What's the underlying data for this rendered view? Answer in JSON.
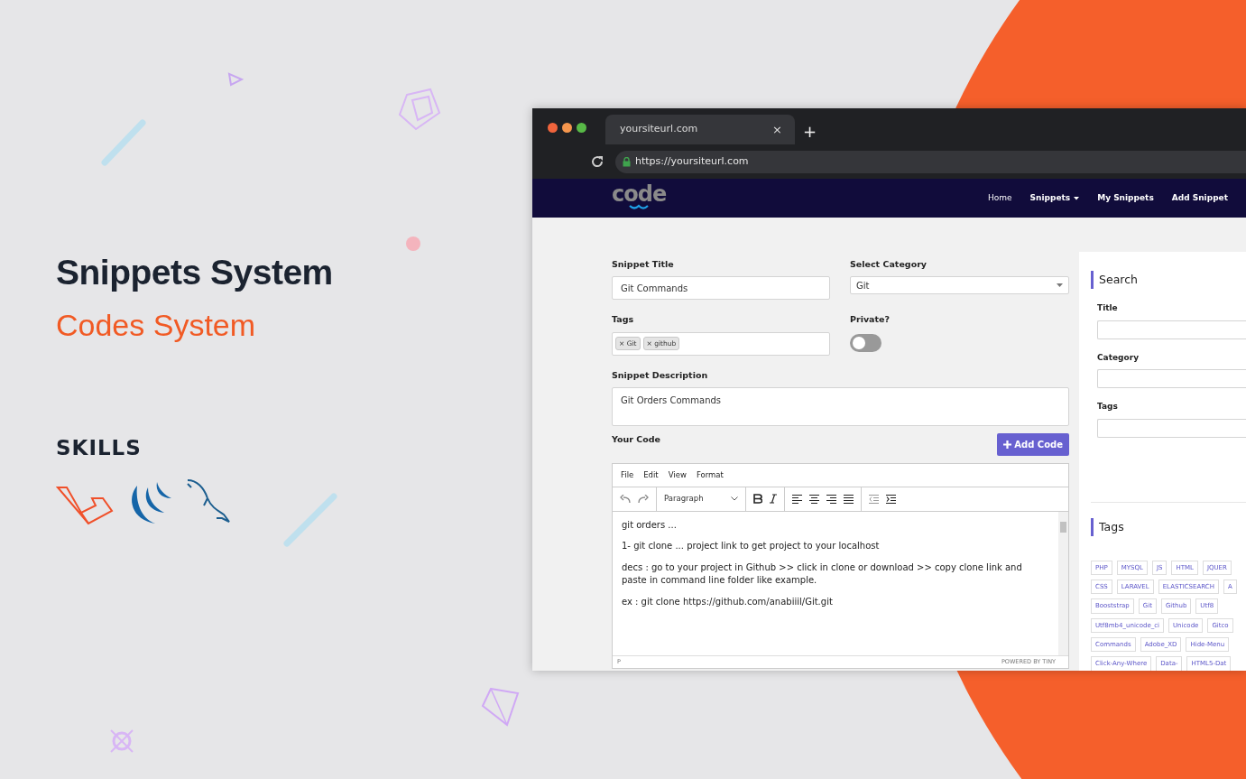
{
  "promo": {
    "title": "Snippets System",
    "subtitle": "Codes System",
    "skills_heading": "SKILLS"
  },
  "browser": {
    "tab_title": "yoursiteurl.com",
    "tab_close": "×",
    "new_tab": "+",
    "url": "https://yoursiteurl.com"
  },
  "navbar": {
    "logo": "code",
    "items": [
      {
        "label": "Home",
        "dropdown": false
      },
      {
        "label": "Snippets",
        "dropdown": true
      },
      {
        "label": "My Snippets",
        "dropdown": false
      },
      {
        "label": "Add Snippet",
        "dropdown": false
      }
    ]
  },
  "form": {
    "title_label": "Snippet Title",
    "title_value": "Git Commands",
    "category_label": "Select Category",
    "category_value": "Git",
    "tags_label": "Tags",
    "tags": [
      {
        "remove": "×",
        "label": "Git"
      },
      {
        "remove": "×",
        "label": "github"
      }
    ],
    "private": {
      "label": "Private?",
      "on": false
    },
    "description_label": "Snippet Description",
    "description_value": "Git Orders Commands",
    "code_label": "Your Code",
    "add_code_button": "Add Code"
  },
  "editor": {
    "menu": [
      "File",
      "Edit",
      "View",
      "Format"
    ],
    "block_format": "Paragraph",
    "paragraphs": [
      "git orders ...",
      "1- git clone ... project link to get project to your localhost",
      "decs : go to your project in Github >> click in clone or download >> copy clone link and paste in command line folder like  example.",
      "ex : git clone https://github.com/anabiiil/Git.git"
    ],
    "status_path": "P",
    "branding": "POWERED BY TINY"
  },
  "search_panel": {
    "title": "Search",
    "fields": [
      {
        "label": "Title"
      },
      {
        "label": "Category"
      },
      {
        "label": "Tags"
      }
    ]
  },
  "tags_panel": {
    "title": "Tags",
    "tag_rows": [
      [
        "PHP",
        "MYSQL",
        "JS",
        "HTML",
        "JQUER"
      ],
      [
        "CSS",
        "LARAVEL",
        "ELASTICSEARCH",
        "A"
      ],
      [
        "Booststrap",
        "Git",
        "Github",
        "Utf8"
      ],
      [
        "Utf8mb4_unicode_ci",
        "Unicode",
        "Gitco"
      ],
      [
        "Commands",
        "Adobe_XD",
        "Hide-Menu"
      ],
      [
        "Click-Any-Where",
        "Data-",
        "HTML5-Dat"
      ]
    ]
  }
}
